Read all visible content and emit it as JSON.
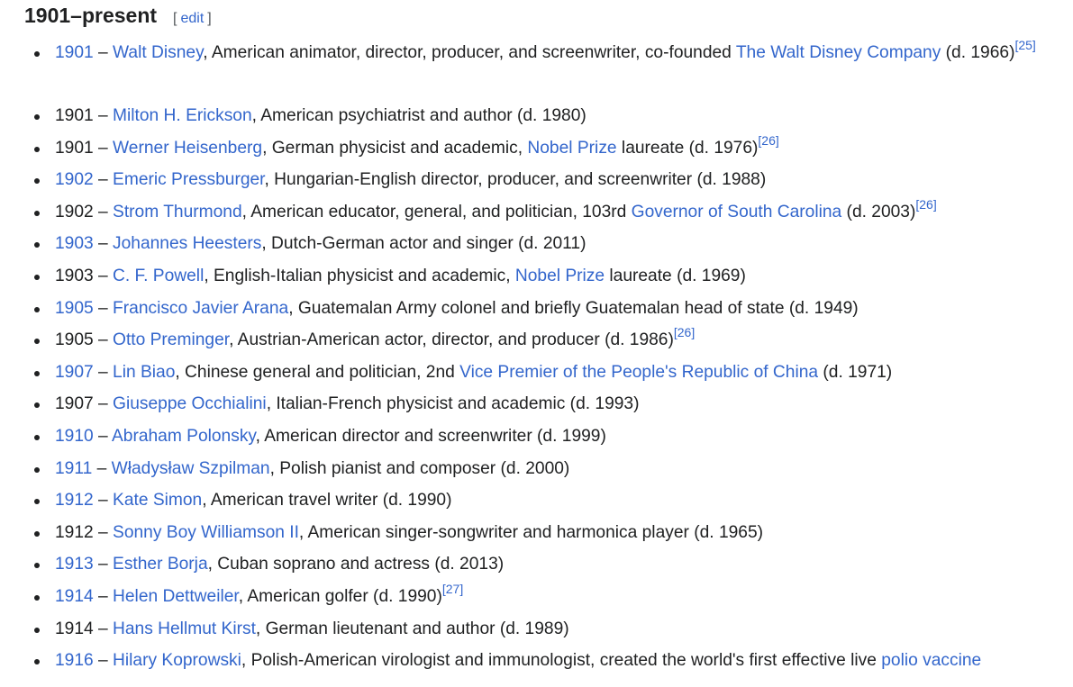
{
  "section": {
    "title": "1901–present",
    "edit_open": "[",
    "edit_label": "edit",
    "edit_close": "]"
  },
  "colors": {
    "text": "#202122",
    "link": "#3366cc"
  },
  "entries": [
    {
      "year": "1901",
      "year_linked": true,
      "name": "Walt Disney",
      "desc": ", American animator, director, producer, and screenwriter, co-founded ",
      "link2": "The Walt Disney Company",
      "desc2": " (d. 1966)",
      "ref": "[25]",
      "two_line": true
    },
    {
      "year": "1901",
      "year_linked": false,
      "name": "Milton H. Erickson",
      "desc": ", American psychiatrist and author (d. 1980)",
      "link2": "",
      "desc2": "",
      "ref": ""
    },
    {
      "year": "1901",
      "year_linked": false,
      "name": "Werner Heisenberg",
      "desc": ", German physicist and academic, ",
      "link2": "Nobel Prize",
      "desc2": " laureate (d. 1976)",
      "ref": "[26]"
    },
    {
      "year": "1902",
      "year_linked": true,
      "name": "Emeric Pressburger",
      "desc": ", Hungarian-English director, producer, and screenwriter (d. 1988)",
      "link2": "",
      "desc2": "",
      "ref": ""
    },
    {
      "year": "1902",
      "year_linked": false,
      "name": "Strom Thurmond",
      "desc": ", American educator, general, and politician, 103rd ",
      "link2": "Governor of South Carolina",
      "desc2": " (d. 2003)",
      "ref": "[26]"
    },
    {
      "year": "1903",
      "year_linked": true,
      "name": "Johannes Heesters",
      "desc": ", Dutch-German actor and singer (d. 2011)",
      "link2": "",
      "desc2": "",
      "ref": ""
    },
    {
      "year": "1903",
      "year_linked": false,
      "name": "C. F. Powell",
      "desc": ", English-Italian physicist and academic, ",
      "link2": "Nobel Prize",
      "desc2": " laureate (d. 1969)",
      "ref": ""
    },
    {
      "year": "1905",
      "year_linked": true,
      "name": "Francisco Javier Arana",
      "desc": ", Guatemalan Army colonel and briefly Guatemalan head of state (d. 1949)",
      "link2": "",
      "desc2": "",
      "ref": ""
    },
    {
      "year": "1905",
      "year_linked": false,
      "name": "Otto Preminger",
      "desc": ", Austrian-American actor, director, and producer (d. 1986)",
      "link2": "",
      "desc2": "",
      "ref": "[26]"
    },
    {
      "year": "1907",
      "year_linked": true,
      "name": "Lin Biao",
      "desc": ", Chinese general and politician, 2nd ",
      "link2": "Vice Premier of the People's Republic of China",
      "desc2": " (d. 1971)",
      "ref": ""
    },
    {
      "year": "1907",
      "year_linked": false,
      "name": "Giuseppe Occhialini",
      "desc": ", Italian-French physicist and academic (d. 1993)",
      "link2": "",
      "desc2": "",
      "ref": ""
    },
    {
      "year": "1910",
      "year_linked": true,
      "name": "Abraham Polonsky",
      "desc": ", American director and screenwriter (d. 1999)",
      "link2": "",
      "desc2": "",
      "ref": ""
    },
    {
      "year": "1911",
      "year_linked": true,
      "name": "Władysław Szpilman",
      "desc": ", Polish pianist and composer (d. 2000)",
      "link2": "",
      "desc2": "",
      "ref": ""
    },
    {
      "year": "1912",
      "year_linked": true,
      "name": "Kate Simon",
      "desc": ", American travel writer (d. 1990)",
      "link2": "",
      "desc2": "",
      "ref": ""
    },
    {
      "year": "1912",
      "year_linked": false,
      "name": "Sonny Boy Williamson II",
      "desc": ", American singer-songwriter and harmonica player (d. 1965)",
      "link2": "",
      "desc2": "",
      "ref": ""
    },
    {
      "year": "1913",
      "year_linked": true,
      "name": "Esther Borja",
      "desc": ", Cuban soprano and actress (d. 2013)",
      "link2": "",
      "desc2": "",
      "ref": ""
    },
    {
      "year": "1914",
      "year_linked": true,
      "name": "Helen Dettweiler",
      "desc": ", American golfer (d. 1990)",
      "link2": "",
      "desc2": "",
      "ref": "[27]"
    },
    {
      "year": "1914",
      "year_linked": false,
      "name": "Hans Hellmut Kirst",
      "desc": ", German lieutenant and author (d. 1989)",
      "link2": "",
      "desc2": "",
      "ref": ""
    },
    {
      "year": "1916",
      "year_linked": true,
      "name": "Hilary Koprowski",
      "desc": ", Polish-American virologist and immunologist, created the world's first effective live ",
      "link2": "polio vaccine",
      "desc2": "",
      "ref": ""
    }
  ]
}
